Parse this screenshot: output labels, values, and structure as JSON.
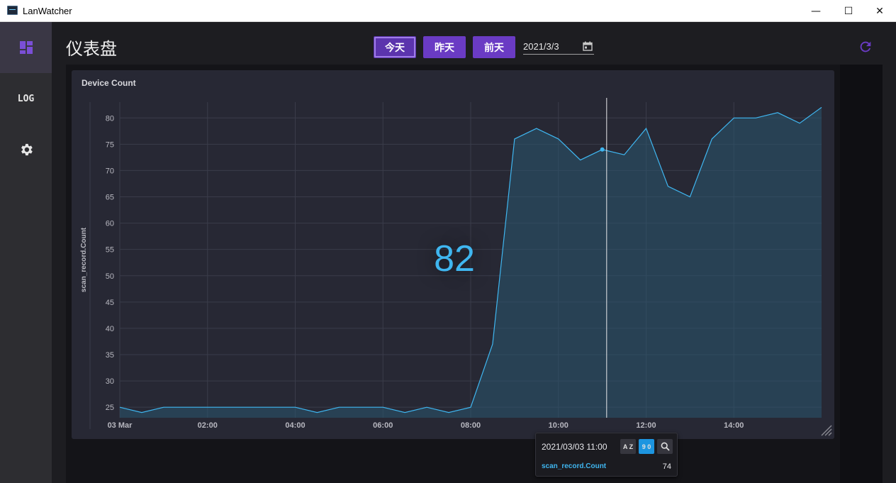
{
  "window": {
    "title": "LanWatcher",
    "controls": {
      "minimize": "—",
      "maximize": "☐",
      "close": "✕"
    }
  },
  "sidebar": {
    "items": [
      {
        "icon": "dashboard-icon",
        "active": true
      },
      {
        "label": "LOG"
      },
      {
        "icon": "gear-icon"
      }
    ]
  },
  "header": {
    "title": "仪表盘",
    "buttons": {
      "today": "今天",
      "yesterday": "昨天",
      "day_before": "前天"
    },
    "date_value": "2021/3/3",
    "refresh_icon": "refresh-icon"
  },
  "panel": {
    "title": "Device Count",
    "stat_value": "82"
  },
  "colors": {
    "accent": "#6a3bc4",
    "series_line": "#3fb6f0",
    "series_fill": "#2a5570",
    "panel_bg": "#272834"
  },
  "chart_data": {
    "type": "area",
    "ylabel": "scan_record.Count",
    "ylim": [
      23,
      83
    ],
    "yticks": [
      25,
      30,
      35,
      40,
      45,
      50,
      55,
      60,
      65,
      70,
      75,
      80
    ],
    "xtick_labels": [
      "03 Mar",
      "02:00",
      "04:00",
      "06:00",
      "08:00",
      "10:00",
      "12:00",
      "14:00"
    ],
    "xrange_hours": [
      0,
      16
    ],
    "grid": true,
    "series": [
      {
        "name": "scan_record.Count",
        "x": [
          0,
          0.5,
          1,
          1.5,
          2,
          2.5,
          3,
          3.5,
          4,
          4.5,
          5,
          5.5,
          6,
          6.5,
          7,
          7.5,
          8,
          8.5,
          9,
          9.5,
          10,
          10.5,
          11,
          11.5,
          12,
          12.5,
          13,
          13.5,
          14,
          14.5,
          15,
          15.5,
          16
        ],
        "values": [
          25,
          24,
          25,
          25,
          25,
          25,
          25,
          25,
          25,
          24,
          25,
          25,
          25,
          24,
          25,
          24,
          25,
          37,
          76,
          78,
          76,
          72,
          74,
          73,
          78,
          67,
          65,
          76,
          80,
          80,
          81,
          79,
          82
        ]
      }
    ],
    "crosshair_hour": 11.1,
    "highlight_point": {
      "x": 11,
      "y": 74
    }
  },
  "tooltip": {
    "time": "2021/03/03 11:00",
    "sort_az": "A Z",
    "sort_90": "9 0",
    "search_icon": "search-icon",
    "series_name": "scan_record.Count",
    "value": "74"
  }
}
